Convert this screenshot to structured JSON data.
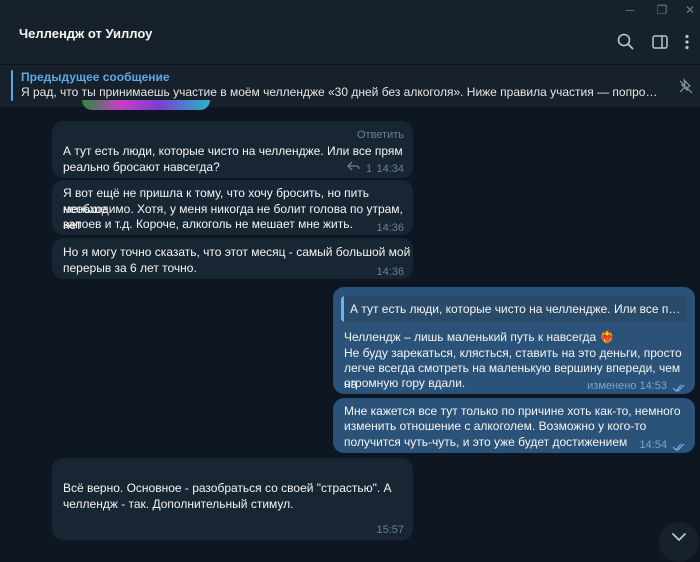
{
  "window": {
    "minimize_glyph": "─",
    "restore_glyph": "❐",
    "close_glyph": "✕"
  },
  "header": {
    "title": "Челлендж от Уиллоу",
    "icons": [
      "search-icon",
      "sidebar-toggle-icon",
      "more-vertical-icon"
    ]
  },
  "pinned": {
    "title": "Предыдущее сообщение",
    "text": "Я рад, что ты принимаешь участие в моём челлендже «30 дней без алкоголя». Ниже правила участия — попрошу тебя..."
  },
  "messages": [
    {
      "line1": "А тут есть люди, которые чисто на челлендже. Или все прям",
      "line2": "реально бросают навсегда?",
      "reply_label": "Ответить",
      "reply_count": "1",
      "time": "14:34"
    },
    {
      "line1": "Я вот ещё не пришла к тому, что хочу бросить, но пить меньше",
      "line2": "необходимо. Хотя, у меня никогда не болит голова по утрам, нет",
      "line3": "запоев и т.д. Короче, алкоголь не мешает мне жить.",
      "time": "14:36"
    },
    {
      "line1": "Но я могу точно сказать, что этот месяц - самый большой мой",
      "line2": "перерыв за 6 лет точно.",
      "time": "14:36"
    },
    {
      "quote": "А тут есть люди, которые чисто на челлендже. Или все прям ...",
      "line1": "Челлендж – лишь маленький путь к навсегда",
      "emoji": "❤️‍🔥",
      "line2": "Не буду зарекаться, клясться, ставить на это деньги, просто",
      "line3": "легче всегда смотреть на маленькую вершину впереди, чем на",
      "line4": "огромную гору вдали.",
      "edited": "изменено",
      "time": "14:53"
    },
    {
      "line1": "Мне кажется все тут только по причине хоть как-то, немного",
      "line2": "изменить отношение с алкоголем. Возможно у кого-то",
      "line3": "получится чуть-чуть, и это уже будет достижением",
      "time": "14:54"
    },
    {
      "line1": "Всё верно. Основное - разобраться со своей \"страстью\". А",
      "line2": "челлендж - так. Дополнительный стимул.",
      "time": "15:57"
    }
  ],
  "colors": {
    "accent": "#5fa8e6",
    "incoming": "#182533",
    "outgoing": "#2b5278",
    "background": "#0e1621"
  }
}
